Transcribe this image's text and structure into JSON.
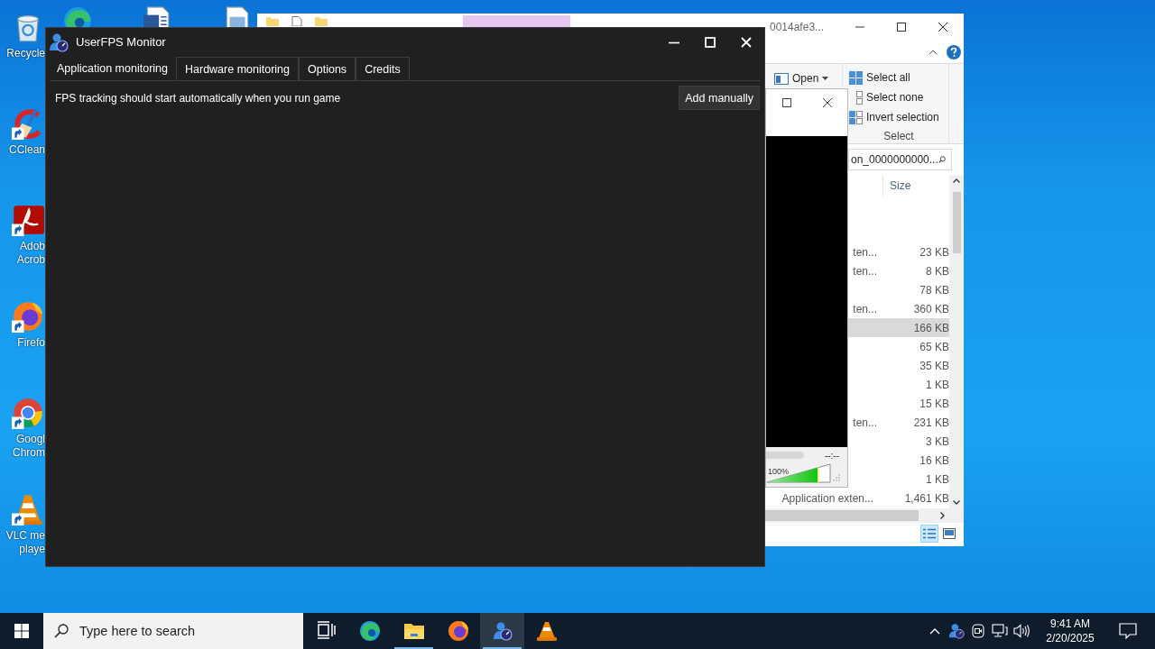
{
  "desktop": {
    "icons": [
      {
        "kind": "recycle-bin",
        "lines": [
          "Recycle"
        ]
      },
      {
        "kind": "ccleaner",
        "lines": [
          "CClean"
        ]
      },
      {
        "kind": "acrobat",
        "lines": [
          "Adob",
          "Acrob"
        ]
      },
      {
        "kind": "firefox",
        "lines": [
          "Firefo"
        ]
      },
      {
        "kind": "chrome",
        "lines": [
          "Googl",
          "Chrom"
        ]
      },
      {
        "kind": "vlc",
        "lines": [
          "VLC me",
          "playe"
        ]
      }
    ],
    "top_icons": [
      {
        "kind": "edge"
      },
      {
        "kind": "word-doc"
      },
      {
        "kind": "file"
      }
    ]
  },
  "explorer": {
    "title": "0014afe3...",
    "ribbon": {
      "open": "Open",
      "select_items": [
        "Select all",
        "Select none",
        "Invert selection"
      ],
      "group_label": "Select"
    },
    "search": {
      "value": "on_0000000000..."
    },
    "columns": [
      "Size"
    ],
    "rows": [
      {
        "type": "ten...",
        "size": "23 KB",
        "selected": false
      },
      {
        "type": "ten...",
        "size": "8 KB",
        "selected": false
      },
      {
        "size": "78 KB",
        "selected": false
      },
      {
        "type": "ten...",
        "size": "360 KB",
        "selected": false
      },
      {
        "size": "166 KB",
        "selected": true
      },
      {
        "size": "65 KB",
        "selected": false
      },
      {
        "size": "35 KB",
        "selected": false
      },
      {
        "size": "1 KB",
        "selected": false
      },
      {
        "size": "15 KB",
        "selected": false
      },
      {
        "type": "ten...",
        "size": "231 KB",
        "selected": false
      },
      {
        "size": "3 KB",
        "selected": false
      },
      {
        "size": "16 KB",
        "selected": false
      },
      {
        "size": "1 KB",
        "selected": false
      },
      {
        "type": "Application exten...",
        "size": "1,461 KB",
        "selected": false
      }
    ]
  },
  "player": {
    "time": "--:--",
    "volume": "100%",
    "level": 0.8
  },
  "app": {
    "title": "UserFPS Monitor",
    "tabs": [
      {
        "label": "Application monitoring",
        "selected": true
      },
      {
        "label": "Hardware monitoring",
        "selected": false
      },
      {
        "label": "Options",
        "selected": false
      },
      {
        "label": "Credits",
        "selected": false
      }
    ],
    "message": "FPS tracking should start automatically when you run game",
    "add_button": "Add manually"
  },
  "taskbar": {
    "search": {
      "placeholder": "Type here to search"
    },
    "apps": [
      {
        "kind": "task-view",
        "selected": false,
        "running": false
      },
      {
        "kind": "edge",
        "selected": false,
        "running": false
      },
      {
        "kind": "explorer",
        "selected": false,
        "running": true
      },
      {
        "kind": "firefox",
        "selected": false,
        "running": false
      },
      {
        "kind": "userfps",
        "selected": true,
        "running": true
      },
      {
        "kind": "vlc",
        "selected": false,
        "running": false
      }
    ],
    "tray": {
      "time": "9:41 AM",
      "date": "2/20/2025"
    }
  }
}
